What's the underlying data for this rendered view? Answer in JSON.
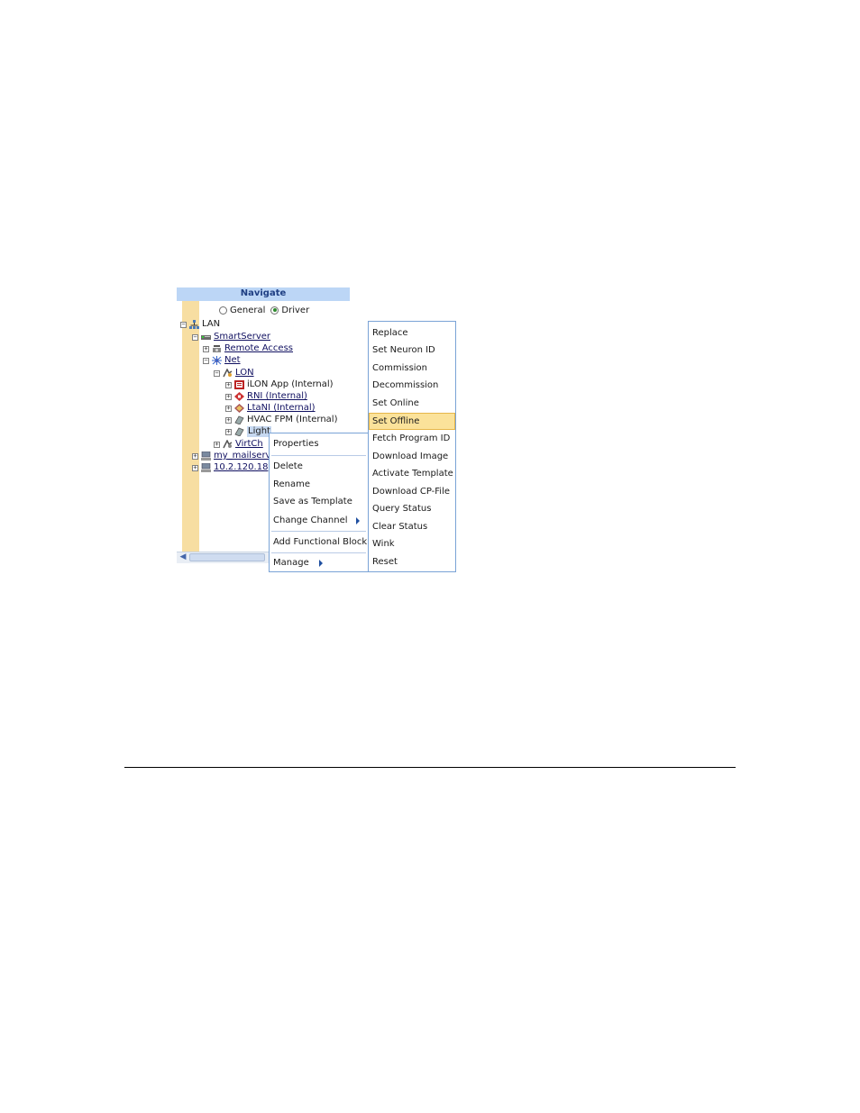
{
  "navigate": {
    "title": "Navigate",
    "view_options": [
      {
        "label": "General",
        "selected": false
      },
      {
        "label": "Driver",
        "selected": true
      }
    ]
  },
  "tree": {
    "lan": "LAN",
    "smartserver": "SmartServer",
    "remote_access": "Remote Access",
    "net": "Net",
    "lon": "LON",
    "ilon_app": "iLON App (Internal)",
    "rni": "RNI (Internal)",
    "ltani": "LtaNI (Internal)",
    "hvac": "HVAC FPM (Internal)",
    "light": "Light",
    "virtch": "VirtCh",
    "mailserv": "my_mailserv",
    "ip": "10.2.120.18"
  },
  "context_menu": {
    "items": [
      "Properties",
      "Delete",
      "Rename",
      "Save as Template",
      "Change Channel",
      "Add Functional Block",
      "Manage"
    ]
  },
  "manage_submenu": {
    "items": [
      "Replace",
      "Set Neuron ID",
      "Commission",
      "Decommission",
      "Set Online",
      "Set Offline",
      "Fetch Program ID",
      "Download Image",
      "Activate Template",
      "Download CP-File",
      "Query Status",
      "Clear Status",
      "Wink",
      "Reset"
    ],
    "highlighted": "Set Offline"
  },
  "colors": {
    "header_bg": "#bcd6f6",
    "gutter": "#f7dea2",
    "menu_border": "#7aa3d6",
    "highlight": "#fbe29a"
  }
}
